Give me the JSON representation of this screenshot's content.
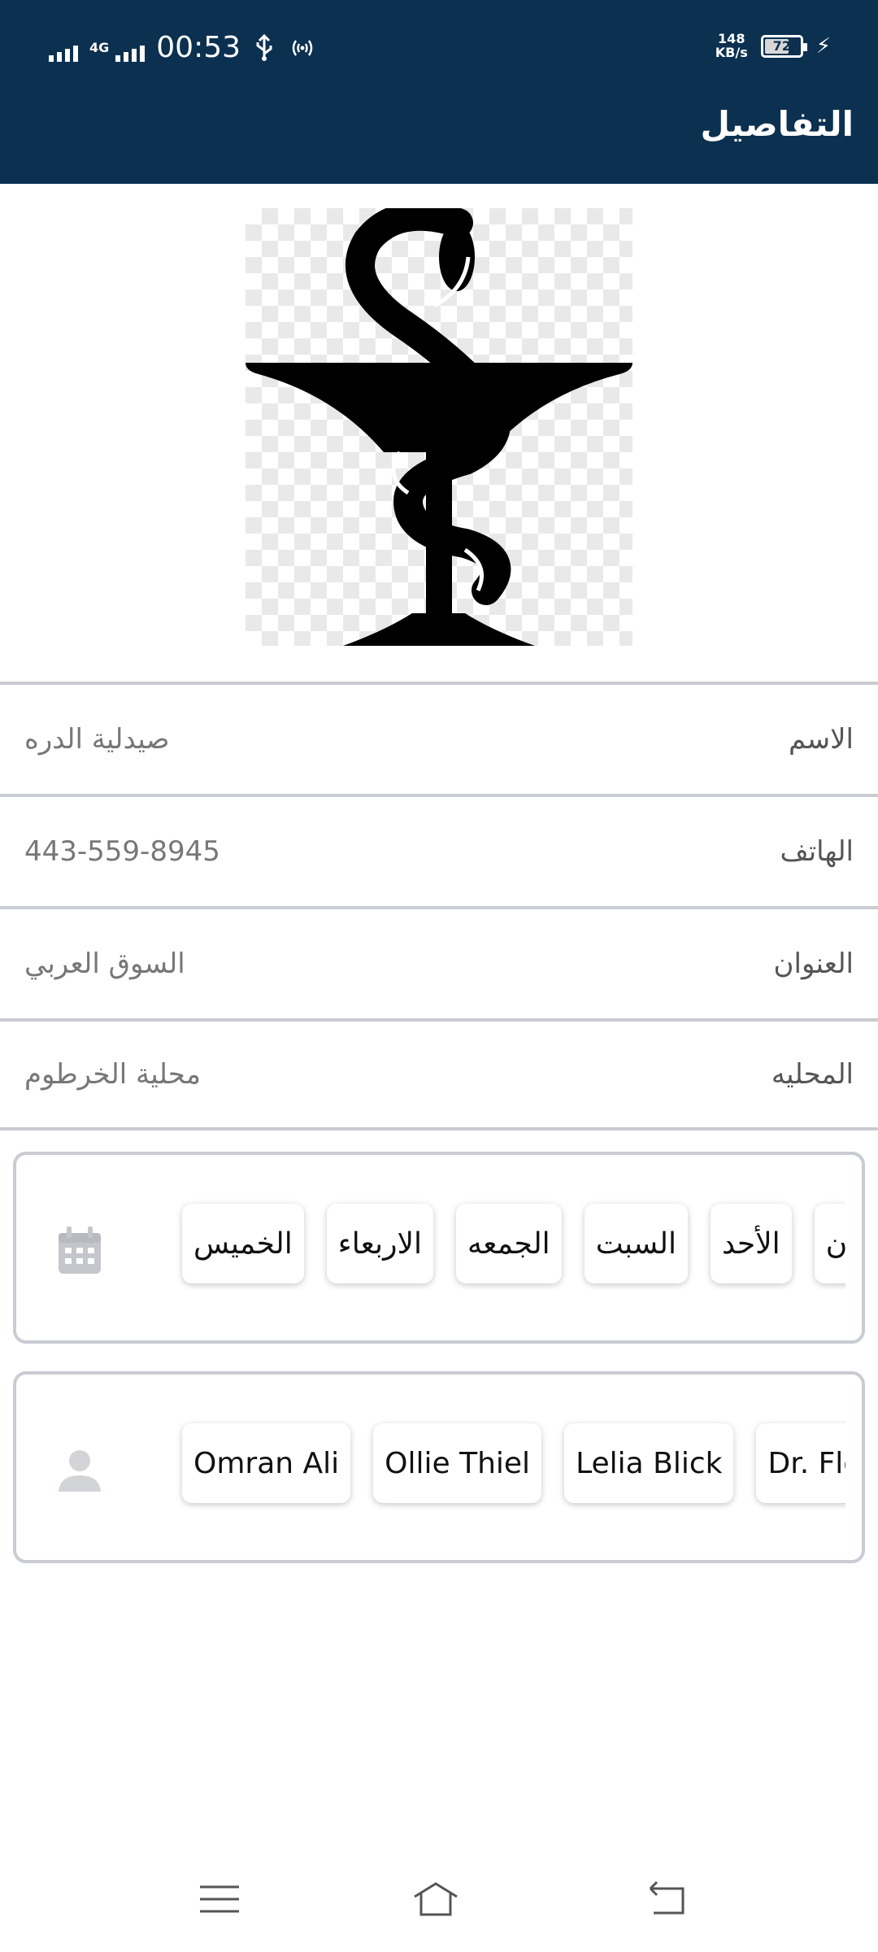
{
  "status_bar": {
    "network": "4G",
    "time": "00:53",
    "speed_value": "148",
    "speed_unit": "KB/s",
    "battery": "72",
    "battery_fraction": 0.72
  },
  "header": {
    "title": "التفاصيل",
    "background": "#0c3050"
  },
  "logo": {
    "icon": "pharmacy-bowl-of-hygieia-icon"
  },
  "details": [
    {
      "label": "الاسم",
      "value": "صيدلية الدره"
    },
    {
      "label": "الهاتف",
      "value": "443-559-8945"
    },
    {
      "label": "العنوان",
      "value": "السوق العربي"
    },
    {
      "label": "المحليه",
      "value": "محلية الخرطوم"
    }
  ],
  "days_card": {
    "icon": "calendar-icon",
    "days": [
      "الخميس",
      "الاربعاء",
      "الجمعه",
      "السبت",
      "الأحد",
      "ن"
    ]
  },
  "doctors_card": {
    "icon": "person-icon",
    "doctors": [
      "Omran Ali",
      "Ollie Thiel",
      "Lelia Blick",
      "Dr. Flor"
    ]
  },
  "nav": {
    "menu": "menu-icon",
    "home": "home-icon",
    "back": "back-icon"
  }
}
